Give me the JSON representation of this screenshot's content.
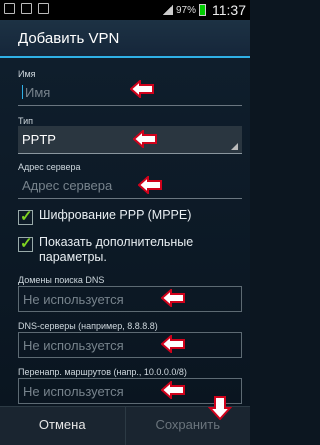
{
  "status_bar": {
    "battery": "97%",
    "time": "11:37"
  },
  "dialog": {
    "title": "Добавить VPN",
    "name": {
      "label": "Имя",
      "placeholder": "Имя"
    },
    "type": {
      "label": "Тип",
      "value": "PPTP"
    },
    "server": {
      "label": "Адрес сервера",
      "placeholder": "Адрес сервера"
    },
    "encryption": {
      "label": "Шифрование PPP (MPPE)",
      "checked": true
    },
    "advanced": {
      "label": "Показать дополнительные параметры.",
      "checked": true
    },
    "dns_domains": {
      "label": "Домены поиска DNS",
      "placeholder": "Не используется"
    },
    "dns_servers": {
      "label": "DNS-серверы (например, 8.8.8.8)",
      "placeholder": "Не используется"
    },
    "routes": {
      "label": "Перенапр. маршрутов (напр., 10.0.0.0/8)",
      "placeholder": "Не используется"
    },
    "cancel_label": "Отмена",
    "save_label": "Сохранить"
  },
  "colors": {
    "accent": "#2fb0e6",
    "check": "#7ed321",
    "arrow": "#d0021b"
  }
}
